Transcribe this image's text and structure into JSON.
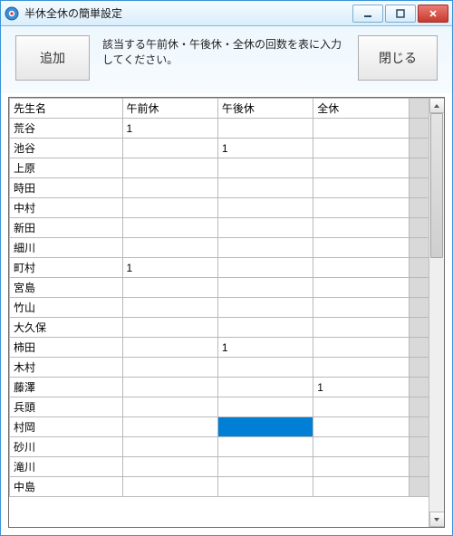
{
  "window": {
    "title": "半休全休の簡単設定"
  },
  "toolbar": {
    "add_label": "追加",
    "instructions": "該当する午前休・午後休・全休の回数を表に入力してください。",
    "close_label": "閉じる"
  },
  "table": {
    "headers": {
      "name": "先生名",
      "am": "午前休",
      "pm": "午後休",
      "full": "全休"
    },
    "rows": [
      {
        "name": "荒谷",
        "am": "1",
        "pm": "",
        "full": ""
      },
      {
        "name": "池谷",
        "am": "",
        "pm": "1",
        "full": ""
      },
      {
        "name": "上原",
        "am": "",
        "pm": "",
        "full": ""
      },
      {
        "name": "時田",
        "am": "",
        "pm": "",
        "full": ""
      },
      {
        "name": "中村",
        "am": "",
        "pm": "",
        "full": ""
      },
      {
        "name": "新田",
        "am": "",
        "pm": "",
        "full": ""
      },
      {
        "name": "細川",
        "am": "",
        "pm": "",
        "full": ""
      },
      {
        "name": "町村",
        "am": "1",
        "pm": "",
        "full": ""
      },
      {
        "name": "宮島",
        "am": "",
        "pm": "",
        "full": ""
      },
      {
        "name": "竹山",
        "am": "",
        "pm": "",
        "full": ""
      },
      {
        "name": "大久保",
        "am": "",
        "pm": "",
        "full": ""
      },
      {
        "name": "柿田",
        "am": "",
        "pm": "1",
        "full": ""
      },
      {
        "name": "木村",
        "am": "",
        "pm": "",
        "full": ""
      },
      {
        "name": "藤澤",
        "am": "",
        "pm": "",
        "full": "1"
      },
      {
        "name": "兵頭",
        "am": "",
        "pm": "",
        "full": ""
      },
      {
        "name": "村岡",
        "am": "",
        "pm": "",
        "full": "",
        "selected_col": "pm"
      },
      {
        "name": "砂川",
        "am": "",
        "pm": "",
        "full": ""
      },
      {
        "name": "滝川",
        "am": "",
        "pm": "",
        "full": ""
      },
      {
        "name": "中島",
        "am": "",
        "pm": "",
        "full": ""
      }
    ]
  }
}
